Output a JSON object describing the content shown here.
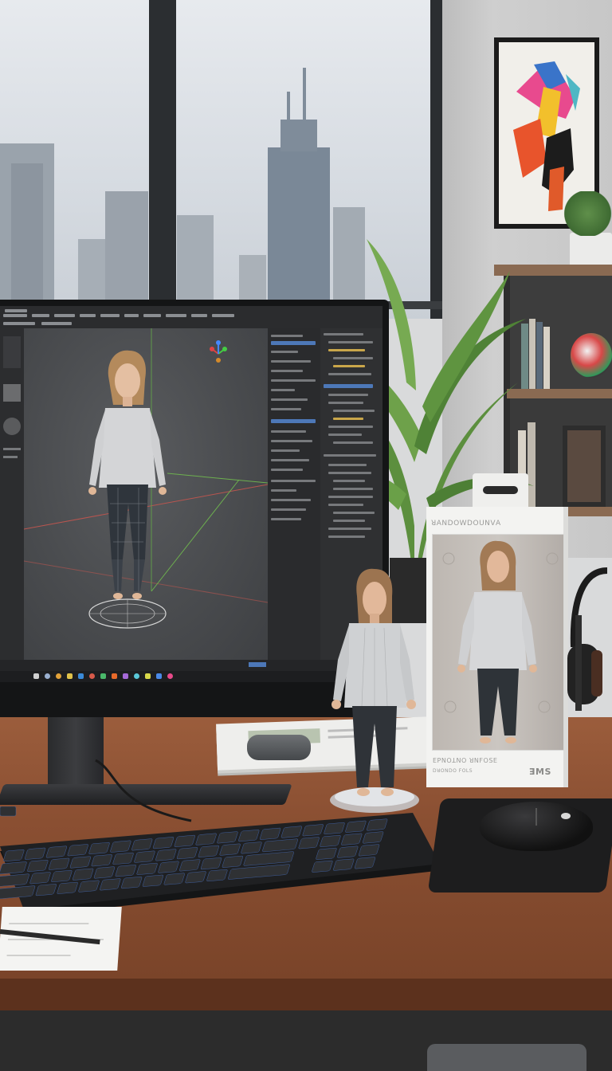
{
  "scene": {
    "description_elements": [
      "window",
      "city-skyline",
      "wall-art",
      "shelf",
      "plant",
      "monitor",
      "desk",
      "keyboard",
      "mouse",
      "figurine",
      "packaging-box",
      "headphones"
    ]
  },
  "packaging": {
    "top_text": "ꓤꓮꓠꓓꓳꓪꓓꓳꓴꓠꓦꓮ",
    "bottom_text": "ꓰꓑꓠꓳꓕꓠꓳ ꓤꓠꓝꓳꓢꓰ",
    "bottom_small": "ꓓꓤꓳꓠꓓꓳ ꓝꓳꓡꓢ",
    "corner_mark": "ꓱꓟꓢ"
  },
  "colors": {
    "shirt": "#cfd1d3",
    "jeans": "#2f3338",
    "hair": "#a07a52",
    "skin": "#e2b89a",
    "desk": "#8a4f32",
    "viewport": "#4a4c4f"
  },
  "icons": [
    "gizmo-icon",
    "windows-start-icon",
    "search-icon",
    "browser-icon",
    "folder-icon",
    "mail-icon"
  ]
}
